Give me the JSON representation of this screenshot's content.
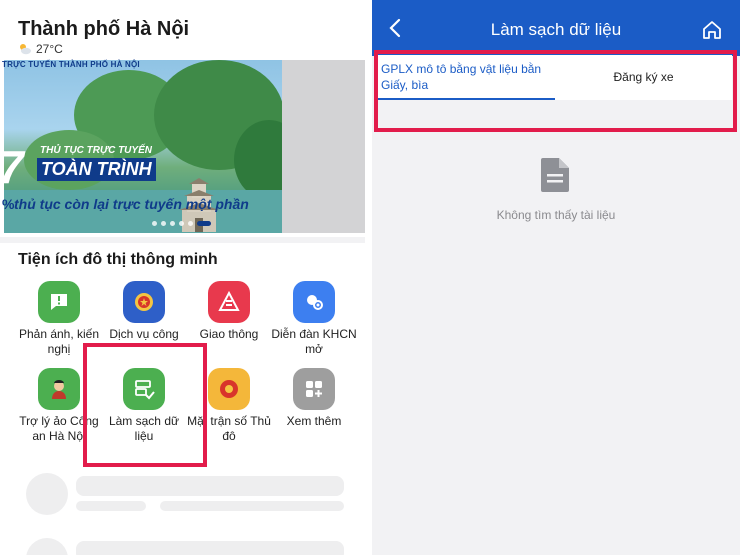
{
  "left": {
    "city": "Thành phố Hà Nội",
    "temperature": "27°C",
    "banner": {
      "top_text": "TRỰC TUYẾN THÀNH PHỐ HÀ NỘI",
      "number": "7",
      "subtitle": "THỦ TỤC TRỰC TUYẾN",
      "headline": "TOÀN TRÌNH",
      "bottom_text": "thủ tục còn lại trực tuyến một phần",
      "bullet": "%"
    },
    "section_title": "Tiện ích đô thị thông minh",
    "utilities": [
      {
        "label": "Phản ánh, kiến nghị",
        "color": "#4caf50"
      },
      {
        "label": "Dịch vụ công",
        "color": "#2e5fc8"
      },
      {
        "label": "Giao thông",
        "color": "#e8394d"
      },
      {
        "label": "Diễn đàn KHCN mở",
        "color": "#3d7ff0"
      },
      {
        "label": "Trợ lý ảo Công an Hà Nội",
        "color": "#4caf50"
      },
      {
        "label": "Làm sạch dữ liệu",
        "color": "#4caf50"
      },
      {
        "label": "Mặt trận số Thủ đô",
        "color": "#f4b73a"
      },
      {
        "label": "Xem thêm",
        "color": "#9e9e9e"
      }
    ]
  },
  "right": {
    "title": "Làm sạch dữ liệu",
    "tabs": [
      {
        "label": "GPLX mô tô bằng vật liệu bằn Giấy, bìa",
        "active": true
      },
      {
        "label": "Đăng ký xe",
        "active": false
      }
    ],
    "empty_message": "Không tìm thấy tài liệu"
  },
  "colors": {
    "primary": "#1b5cc6",
    "highlight": "#e21c4b",
    "background": "#f2f2f4"
  }
}
